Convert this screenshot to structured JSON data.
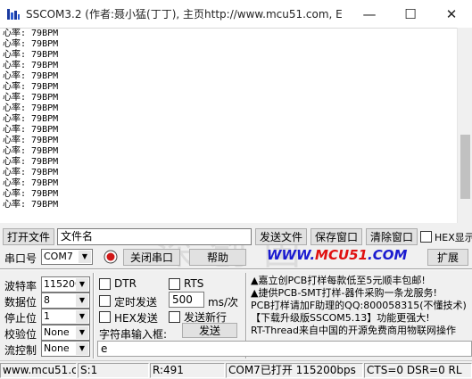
{
  "window": {
    "title": "SSCOM3.2 (作者:聂小猛(丁丁), 主页http://www.mcu51.com,  E...",
    "minimize": "—",
    "maximize": "☐",
    "close": "✕"
  },
  "receive": {
    "lines": [
      "心率: 79BPM",
      "心率: 79BPM",
      "心率: 79BPM",
      "心率: 79BPM",
      "心率: 79BPM",
      "心率: 79BPM",
      "心率: 79BPM",
      "心率: 79BPM",
      "心率: 79BPM",
      "心率: 79BPM",
      "心率: 79BPM",
      "心率: 79BPM",
      "心率: 79BPM",
      "心率: 79BPM",
      "心率: 79BPM",
      "心率: 79BPM",
      "心率: 79BPM"
    ]
  },
  "row1": {
    "open_file": "打开文件",
    "file_name": "文件名",
    "send_file": "发送文件",
    "save_window": "保存窗口",
    "clear_window": "清除窗口",
    "hex_display": "HEX显示"
  },
  "row2": {
    "port_label": "串口号",
    "port_value": "COM7",
    "close_port": "关闭串口",
    "help": "帮助",
    "expand": "扩展"
  },
  "mcu_link": {
    "prefix": "WWW.",
    "accent": "MCU51",
    "suffix": ".COM"
  },
  "watermark": "深创国",
  "settings": {
    "baud_label": "波特率",
    "baud_value": "115200",
    "databits_label": "数据位",
    "databits_value": "8",
    "stopbits_label": "停止位",
    "stopbits_value": "1",
    "parity_label": "校验位",
    "parity_value": "None",
    "flow_label": "流控制",
    "flow_value": "None"
  },
  "options": {
    "dtr": "DTR",
    "rts": "RTS",
    "timed_send": "定时发送",
    "interval_value": "500",
    "interval_unit": "ms/次",
    "hex_send": "HEX发送",
    "send_newline": "发送新行",
    "input_label": "字符串输入框:",
    "send_button": "发送",
    "send_text": "e"
  },
  "ads": [
    "▲嘉立创PCB打样每款低至5元顺丰包邮!",
    "▲捷供PCB-SMT打样-器件采购一条龙服务!",
    "PCB打样请加F助理的QQ:800058315(不懂技术)",
    "【下载升级版SSCOM5.13】功能更强大!",
    "RT-Thread来自中国的开源免费商用物联网操作"
  ],
  "status": {
    "site": "www.mcu51.cor",
    "sent": "S:1",
    "received": "R:491",
    "port_state": "COM7已打开  115200bps",
    "signals": "CTS=0 DSR=0 RL"
  }
}
